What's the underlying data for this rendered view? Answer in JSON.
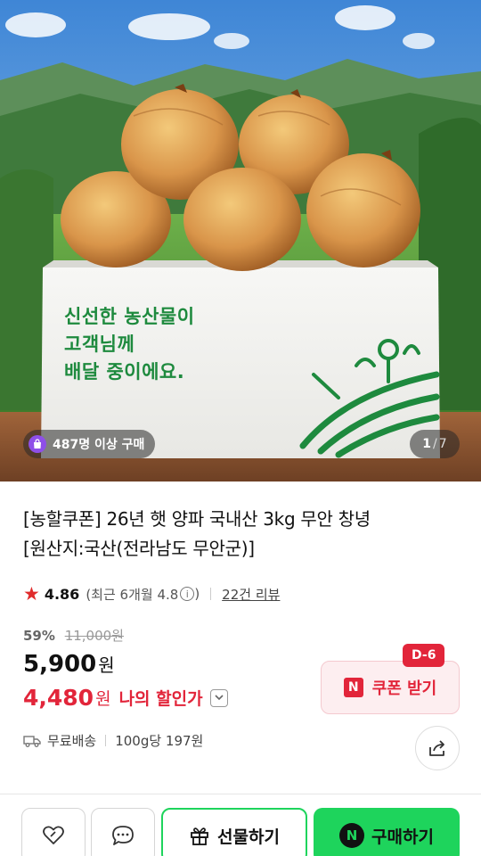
{
  "gallery": {
    "box_text": [
      "신선한 농산물이",
      "고객님께",
      "배달 중이에요."
    ],
    "buyers_badge": "487명 이상 구매",
    "counter": {
      "current": "1",
      "separator": "/",
      "total": "7"
    }
  },
  "product": {
    "title_lines": [
      "[농할쿠폰] 26년 햇 양파 국내산 3kg 무안 창녕",
      "[원산지:국산(전라남도 무안군)]"
    ],
    "rating": "4.86",
    "recent_rating": "(최근 6개월 4.8",
    "recent_rating_close": ")",
    "info_glyph": "i",
    "review_count": "22건 리뷰",
    "discount_rate": "59%",
    "original_price": "11,000원",
    "price": "5,900",
    "price_unit": "원",
    "my_price": "4,480",
    "my_price_unit": "원",
    "my_discount_label": "나의 할인가",
    "shipping": "무료배송",
    "unit_price": "100g당 197원"
  },
  "coupon": {
    "dday": "D-6",
    "logo": "N",
    "label": "쿠폰 받기"
  },
  "bottom_bar": {
    "gift_label": "선물하기",
    "buy_logo": "N",
    "buy_label": "구매하기"
  },
  "icons": {
    "star": "star-icon",
    "wishlist": "heart-icon",
    "talk": "chat-bubble-icon",
    "gift": "gift-box-icon",
    "share": "share-icon",
    "shipping": "truck-icon",
    "badge": "shopping-bag-icon"
  },
  "colors": {
    "accent_red": "#e2253a",
    "naver_green": "#1ed45c",
    "box_green": "#1e8a3e",
    "star_red": "#e02c2c"
  }
}
